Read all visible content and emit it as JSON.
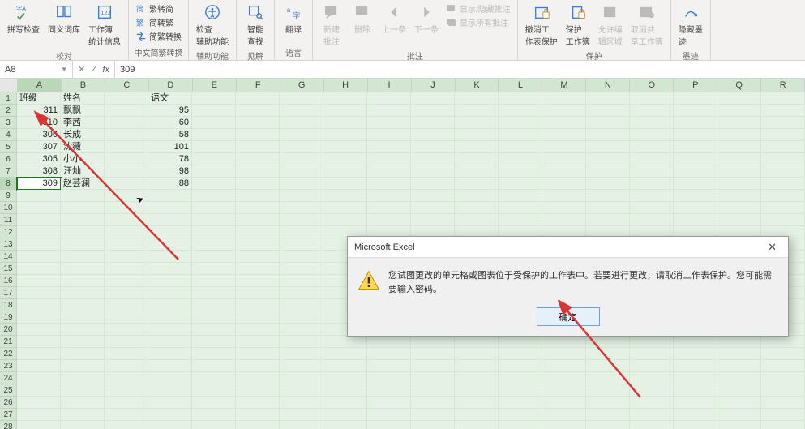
{
  "ribbon": {
    "groups": [
      {
        "label": "校对",
        "buttons": [
          {
            "name": "spellcheck-button",
            "label": "拼写检查",
            "icon": "abc",
            "size": "large"
          },
          {
            "name": "thesaurus-button",
            "label": "同义词库",
            "icon": "book",
            "size": "large"
          },
          {
            "name": "workbook-stats-button",
            "label": "工作簿\n统计信息",
            "icon": "stats",
            "size": "large"
          }
        ]
      },
      {
        "label": "中文简繁转换",
        "buttons": [
          {
            "name": "trad-to-simp-button",
            "label": "繁转简",
            "icon": "ts",
            "size": "small"
          },
          {
            "name": "simp-to-trad-button",
            "label": "简转繁",
            "icon": "st",
            "size": "small"
          },
          {
            "name": "simp-trad-convert-button",
            "label": "简繁转换",
            "icon": "conv",
            "size": "small"
          }
        ]
      },
      {
        "label": "辅助功能",
        "buttons": [
          {
            "name": "check-accessibility-button",
            "label": "检查\n辅助功能",
            "icon": "accessibility",
            "size": "large"
          }
        ]
      },
      {
        "label": "见解",
        "buttons": [
          {
            "name": "smart-lookup-button",
            "label": "智能\n查找",
            "icon": "lookup",
            "size": "large"
          }
        ]
      },
      {
        "label": "语言",
        "buttons": [
          {
            "name": "translate-button",
            "label": "翻译",
            "icon": "translate",
            "size": "large"
          }
        ]
      },
      {
        "label": "批注",
        "buttons": [
          {
            "name": "new-comment-button",
            "label": "新建\n批注",
            "icon": "new-comment",
            "size": "large",
            "disabled": true
          },
          {
            "name": "delete-comment-button",
            "label": "删除",
            "icon": "delete",
            "size": "large",
            "disabled": true
          },
          {
            "name": "prev-comment-button",
            "label": "上一条",
            "icon": "prev",
            "size": "large",
            "disabled": true
          },
          {
            "name": "next-comment-button",
            "label": "下一条",
            "icon": "next",
            "size": "large",
            "disabled": true
          },
          {
            "name": "show-hide-comment-button",
            "label": "显示/隐藏批注",
            "icon": "showhide",
            "size": "small",
            "disabled": true
          },
          {
            "name": "show-all-comments-button",
            "label": "显示所有批注",
            "icon": "showall",
            "size": "small",
            "disabled": true
          }
        ]
      },
      {
        "label": "保护",
        "buttons": [
          {
            "name": "unprotect-sheet-button",
            "label": "撤消工\n作表保护",
            "icon": "unprotect-sheet",
            "size": "large"
          },
          {
            "name": "protect-workbook-button",
            "label": "保护\n工作簿",
            "icon": "protect-wb",
            "size": "large"
          },
          {
            "name": "allow-edit-ranges-button",
            "label": "允许编\n辑区域",
            "icon": "allow-edit",
            "size": "large",
            "disabled": true
          },
          {
            "name": "unshare-workbook-button",
            "label": "取消共\n享工作簿",
            "icon": "unshare",
            "size": "large",
            "disabled": true
          }
        ]
      },
      {
        "label": "墨迹",
        "buttons": [
          {
            "name": "hide-ink-button",
            "label": "隐藏墨\n迹",
            "icon": "ink",
            "size": "large"
          }
        ]
      }
    ]
  },
  "formulaBar": {
    "nameBox": "A8",
    "cancel": "✕",
    "confirm": "✓",
    "fx": "fx",
    "value": "309"
  },
  "columns": [
    "A",
    "B",
    "C",
    "D",
    "E",
    "F",
    "G",
    "H",
    "I",
    "J",
    "K",
    "L",
    "M",
    "N",
    "O",
    "P",
    "Q",
    "R"
  ],
  "selectedCol": 0,
  "selectedRow": 8,
  "rowCount": 28,
  "table": {
    "headers": [
      "班级",
      "姓名",
      "",
      "语文"
    ],
    "rows": [
      [
        "311",
        "飘飘",
        "",
        "95"
      ],
      [
        "310",
        "李茜",
        "",
        "60"
      ],
      [
        "306",
        "长成",
        "",
        "58"
      ],
      [
        "307",
        "沈薇",
        "",
        "101"
      ],
      [
        "305",
        "小小",
        "",
        "78"
      ],
      [
        "308",
        "汪灿",
        "",
        "98"
      ],
      [
        "309",
        "赵芸澜",
        "",
        "88"
      ]
    ]
  },
  "dialog": {
    "title": "Microsoft Excel",
    "message": "您试图更改的单元格或图表位于受保护的工作表中。若要进行更改，请取消工作表保护。您可能需要输入密码。",
    "ok": "确定"
  },
  "colors": {
    "cellbg": "#e4f1e4",
    "selOutline": "#1a7a1a",
    "arrow": "#d33"
  }
}
